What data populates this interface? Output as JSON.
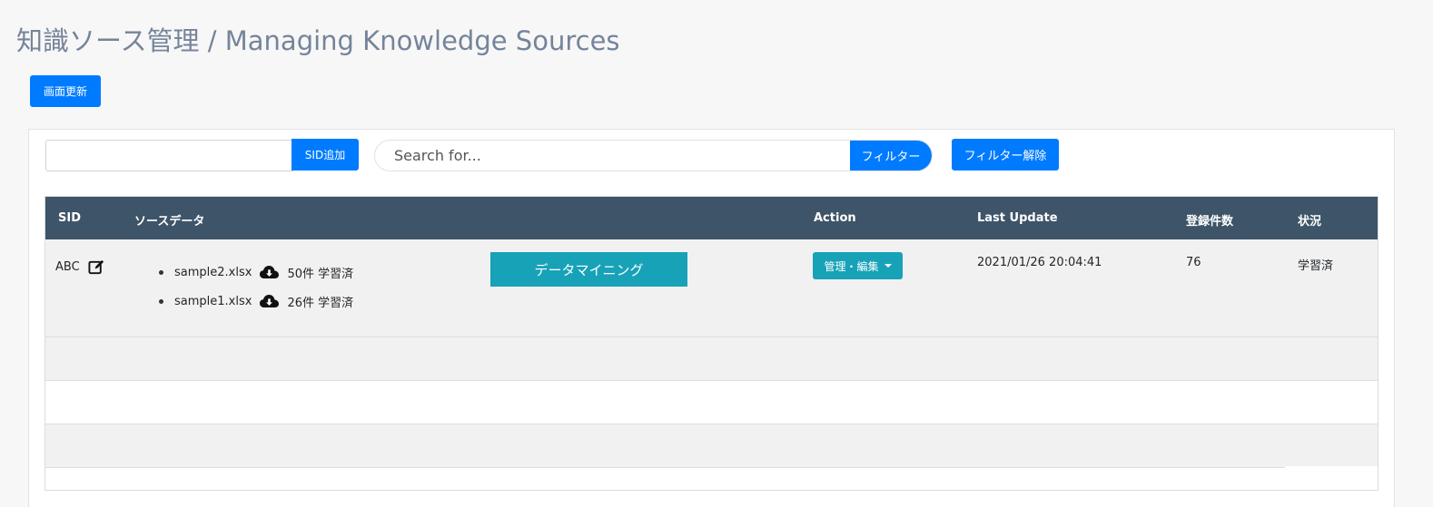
{
  "page": {
    "title": "知識ソース管理 / Managing Knowledge Sources",
    "refresh_label": "画面更新"
  },
  "toolbar": {
    "sid_input_value": "",
    "sid_add_label": "SID追加",
    "search_placeholder": "Search for...",
    "filter_label": "フィルター",
    "clear_filter_label": "フィルター解除"
  },
  "table": {
    "headers": {
      "sid": "SID",
      "source": "ソースデータ",
      "action": "Action",
      "last_update": "Last Update",
      "count": "登録件数",
      "status": "状況"
    },
    "rows": [
      {
        "sid": "ABC",
        "sources": [
          {
            "file": "sample2.xlsx",
            "info": "50件 学習済"
          },
          {
            "file": "sample1.xlsx",
            "info": "26件 学習済"
          }
        ],
        "mining_label": "データマイニング",
        "manage_label": "管理・編集",
        "last_update": "2021/01/26 20:04:41",
        "count": "76",
        "status": "学習済"
      }
    ]
  },
  "icons": {
    "edit": "edit-icon",
    "download": "cloud-download-icon",
    "caret": "caret-down-icon"
  },
  "colors": {
    "primary": "#007bff",
    "info": "#17a2b8",
    "header_bg": "#3e5468",
    "title": "#75849a"
  }
}
